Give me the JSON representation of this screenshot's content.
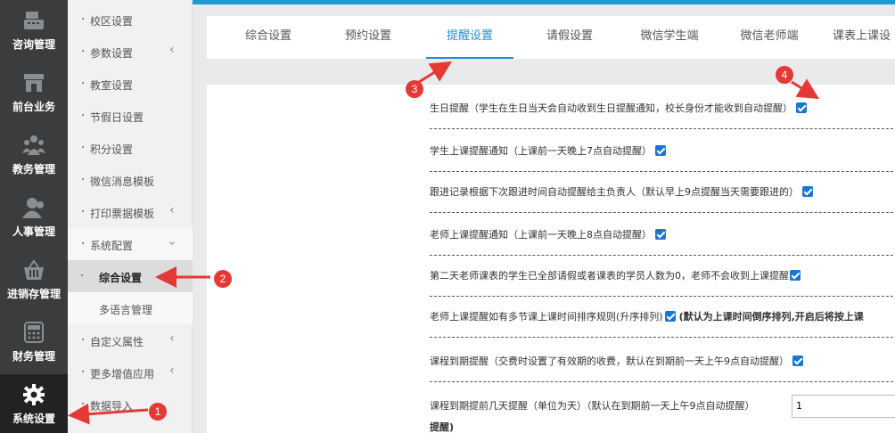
{
  "left_nav": [
    {
      "label": "咨询管理",
      "icon": "register-icon"
    },
    {
      "label": "前台业务",
      "icon": "store-icon"
    },
    {
      "label": "教务管理",
      "icon": "people-group-icon"
    },
    {
      "label": "人事管理",
      "icon": "person-icon"
    },
    {
      "label": "进销存管理",
      "icon": "basket-icon"
    },
    {
      "label": "财务管理",
      "icon": "calculator-icon"
    },
    {
      "label": "系统设置",
      "icon": "gear-icon"
    }
  ],
  "sub_nav": [
    {
      "label": "校区设置"
    },
    {
      "label": "参数设置"
    },
    {
      "label": "教室设置"
    },
    {
      "label": "节假日设置"
    },
    {
      "label": "积分设置"
    },
    {
      "label": "微信消息模板"
    },
    {
      "label": "打印票据模板"
    },
    {
      "label": "系统配置"
    },
    {
      "label": "综合设置"
    },
    {
      "label": "多语言管理"
    },
    {
      "label": "自定义属性"
    },
    {
      "label": "更多增值应用"
    },
    {
      "label": "数据导入"
    }
  ],
  "tabs": [
    "综合设置",
    "预约设置",
    "提醒设置",
    "请假设置",
    "微信学生端",
    "微信老师端",
    "课表上课设"
  ],
  "rows": [
    {
      "text": "生日提醒（学生在生日当天会自动收到生日提醒通知，校长身份才能收到自动提醒）"
    },
    {
      "text": "学生上课提醒通知（上课前一天晚上7点自动提醒）"
    },
    {
      "text": "跟进记录根据下次跟进时间自动提醒给主负责人（默认早上9点提醒当天需要跟进的）"
    },
    {
      "text": "老师上课提醒通知（上课前一天晚上8点自动提醒）"
    },
    {
      "text": "第二天老师课表的学生已全部请假或者课表的学员人数为0，老师不会收到上课提醒"
    },
    {
      "text": "老师上课提醒如有多节课上课时间排序规则(升序排列)",
      "note": "(默认为上课时间倒序排列,开启后将按上课"
    },
    {
      "text": "课程到期提醒（交费时设置了有效期的收费，默认在到期前一天上午9点自动提醒）"
    },
    {
      "text": "课程到期提前几天提醒（单位为天）（默认在到期前一天上午9点自动提醒）",
      "text2": "提醒)",
      "value": "1"
    }
  ],
  "annotations": [
    "1",
    "2",
    "3",
    "4"
  ],
  "colors": {
    "accent": "#1e8fd5",
    "sidebar": "#3a3c3e",
    "annotation": "#e53935"
  }
}
